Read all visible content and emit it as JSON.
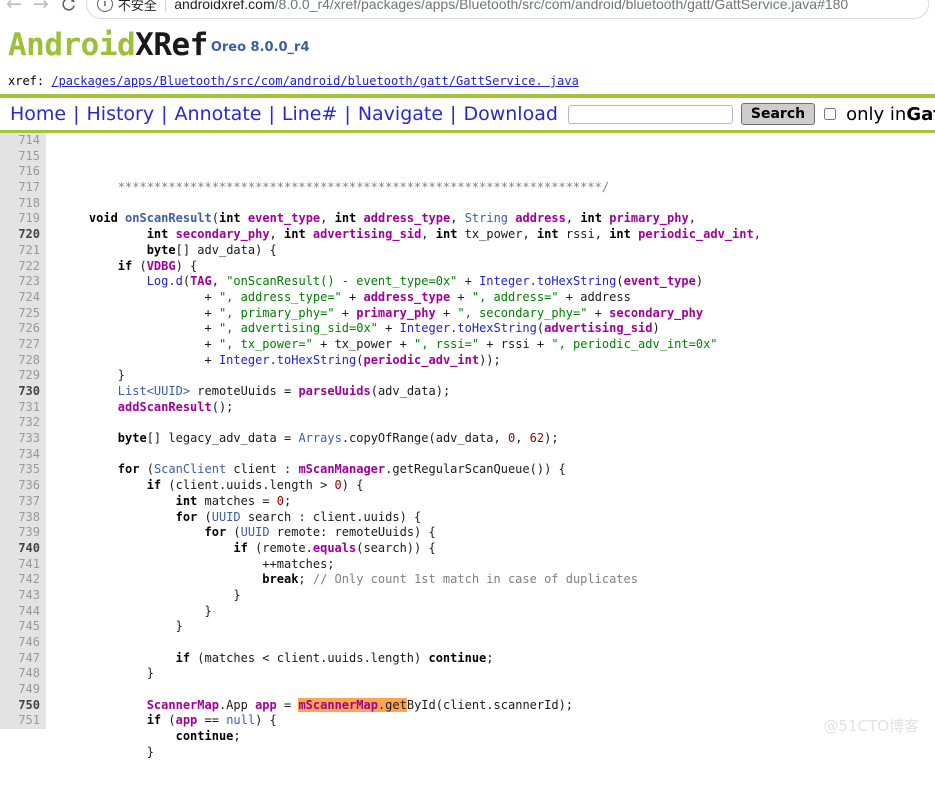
{
  "browser": {
    "back_icon": "back-arrow-icon",
    "forward_icon": "forward-arrow-icon",
    "reload_icon": "reload-icon",
    "info_icon": "info-circle-icon",
    "security_label": "不安全",
    "url_host": "androidxref.com",
    "url_path": "/8.0.0_r4/xref/packages/apps/Bluetooth/src/com/android/bluetooth/gatt/GattService.java#180",
    "url_full": "androidxref.com/8.0.0_r4/xref/packages/apps/Bluetooth/src/com/android/bluetooth/gatt/GattService.java#180"
  },
  "header": {
    "logo_android": "Android",
    "logo_xref": "XRef",
    "version": "Oreo 8.0.0_r4",
    "accent_green": "#a2c63b",
    "logo_green": "#9dc03b",
    "link_blue": "#2929cc"
  },
  "xref": {
    "label": "xref:",
    "segments": [
      "/packages",
      "/apps",
      "/Bluetooth",
      "/src",
      "/com",
      "/android",
      "/bluetooth",
      "/gatt",
      "/GattService. java"
    ],
    "full": "/packages/apps/Bluetooth/src/com/android/bluetooth/gatt/GattService. java"
  },
  "menu": {
    "links": [
      "Home",
      "History",
      "Annotate",
      "Line#",
      "Navigate",
      "Download"
    ],
    "separator": "|",
    "search_value": "",
    "search_placeholder": "",
    "search_button": "Search",
    "only_checked": false,
    "only_label": "only in",
    "only_file": "GattService"
  },
  "code": {
    "highlight_color": "#ffa64d",
    "first_line": 714,
    "lines": [
      {
        "n": 714,
        "tokens": [
          {
            "t": "        ",
            "c": "plain"
          },
          {
            "t": "*******************************************************************/",
            "c": "cmt"
          }
        ]
      },
      {
        "n": 715,
        "tokens": []
      },
      {
        "n": 716,
        "tokens": [
          {
            "t": "    ",
            "c": "plain"
          },
          {
            "t": "void",
            "c": "kw"
          },
          {
            "t": " ",
            "c": "plain"
          },
          {
            "t": "onScanResult",
            "c": "methdef"
          },
          {
            "t": "(",
            "c": "plain"
          },
          {
            "t": "int",
            "c": "kw"
          },
          {
            "t": " ",
            "c": "plain"
          },
          {
            "t": "event_type",
            "c": "id"
          },
          {
            "t": ", ",
            "c": "plain"
          },
          {
            "t": "int",
            "c": "kw"
          },
          {
            "t": " ",
            "c": "plain"
          },
          {
            "t": "address_type",
            "c": "id"
          },
          {
            "t": ", ",
            "c": "plain"
          },
          {
            "t": "String",
            "c": "type"
          },
          {
            "t": " ",
            "c": "plain"
          },
          {
            "t": "address",
            "c": "id"
          },
          {
            "t": ", ",
            "c": "plain"
          },
          {
            "t": "int",
            "c": "kw"
          },
          {
            "t": " ",
            "c": "plain"
          },
          {
            "t": "primary_phy",
            "c": "id"
          },
          {
            "t": ",",
            "c": "plain"
          }
        ]
      },
      {
        "n": 717,
        "tokens": [
          {
            "t": "            ",
            "c": "plain"
          },
          {
            "t": "int",
            "c": "kw"
          },
          {
            "t": " ",
            "c": "plain"
          },
          {
            "t": "secondary_phy",
            "c": "id"
          },
          {
            "t": ", ",
            "c": "plain"
          },
          {
            "t": "int",
            "c": "kw"
          },
          {
            "t": " ",
            "c": "plain"
          },
          {
            "t": "advertising_sid",
            "c": "id"
          },
          {
            "t": ", ",
            "c": "plain"
          },
          {
            "t": "int",
            "c": "kw"
          },
          {
            "t": " ",
            "c": "plain"
          },
          {
            "t": "tx_power",
            "c": "plain"
          },
          {
            "t": ", ",
            "c": "plain"
          },
          {
            "t": "int",
            "c": "kw"
          },
          {
            "t": " ",
            "c": "plain"
          },
          {
            "t": "rssi",
            "c": "plain"
          },
          {
            "t": ", ",
            "c": "plain"
          },
          {
            "t": "int",
            "c": "kw"
          },
          {
            "t": " ",
            "c": "plain"
          },
          {
            "t": "periodic_adv_int",
            "c": "id"
          },
          {
            "t": ",",
            "c": "plain"
          }
        ]
      },
      {
        "n": 718,
        "tokens": [
          {
            "t": "            ",
            "c": "plain"
          },
          {
            "t": "byte",
            "c": "kw"
          },
          {
            "t": "[] ",
            "c": "plain"
          },
          {
            "t": "adv_data",
            "c": "plain"
          },
          {
            "t": ") {",
            "c": "plain"
          }
        ]
      },
      {
        "n": 719,
        "tokens": [
          {
            "t": "        ",
            "c": "plain"
          },
          {
            "t": "if",
            "c": "kw"
          },
          {
            "t": " (",
            "c": "plain"
          },
          {
            "t": "VDBG",
            "c": "id"
          },
          {
            "t": ") {",
            "c": "plain"
          }
        ]
      },
      {
        "n": 720,
        "tokens": [
          {
            "t": "            ",
            "c": "plain"
          },
          {
            "t": "Log.d",
            "c": "meth"
          },
          {
            "t": "(",
            "c": "plain"
          },
          {
            "t": "TAG",
            "c": "id"
          },
          {
            "t": ", ",
            "c": "plain"
          },
          {
            "t": "\"onScanResult() - event_type=0x\"",
            "c": "str"
          },
          {
            "t": " + ",
            "c": "plain"
          },
          {
            "t": "Integer.toHexString",
            "c": "meth"
          },
          {
            "t": "(",
            "c": "plain"
          },
          {
            "t": "event_type",
            "c": "id"
          },
          {
            "t": ")",
            "c": "plain"
          }
        ]
      },
      {
        "n": 721,
        "tokens": [
          {
            "t": "                    + ",
            "c": "plain"
          },
          {
            "t": "\", address_type=\"",
            "c": "str"
          },
          {
            "t": " + ",
            "c": "plain"
          },
          {
            "t": "address_type",
            "c": "id"
          },
          {
            "t": " + ",
            "c": "plain"
          },
          {
            "t": "\", address=\"",
            "c": "str"
          },
          {
            "t": " + ",
            "c": "plain"
          },
          {
            "t": "address",
            "c": "plain"
          }
        ]
      },
      {
        "n": 722,
        "tokens": [
          {
            "t": "                    + ",
            "c": "plain"
          },
          {
            "t": "\", primary_phy=\"",
            "c": "str"
          },
          {
            "t": " + ",
            "c": "plain"
          },
          {
            "t": "primary_phy",
            "c": "id"
          },
          {
            "t": " + ",
            "c": "plain"
          },
          {
            "t": "\", secondary_phy=\"",
            "c": "str"
          },
          {
            "t": " + ",
            "c": "plain"
          },
          {
            "t": "secondary_phy",
            "c": "id"
          }
        ]
      },
      {
        "n": 723,
        "tokens": [
          {
            "t": "                    + ",
            "c": "plain"
          },
          {
            "t": "\", advertising_sid=0x\"",
            "c": "str"
          },
          {
            "t": " + ",
            "c": "plain"
          },
          {
            "t": "Integer.toHexString",
            "c": "meth"
          },
          {
            "t": "(",
            "c": "plain"
          },
          {
            "t": "advertising_sid",
            "c": "id"
          },
          {
            "t": ")",
            "c": "plain"
          }
        ]
      },
      {
        "n": 724,
        "tokens": [
          {
            "t": "                    + ",
            "c": "plain"
          },
          {
            "t": "\", tx_power=\"",
            "c": "str"
          },
          {
            "t": " + ",
            "c": "plain"
          },
          {
            "t": "tx_power",
            "c": "plain"
          },
          {
            "t": " + ",
            "c": "plain"
          },
          {
            "t": "\", rssi=\"",
            "c": "str"
          },
          {
            "t": " + ",
            "c": "plain"
          },
          {
            "t": "rssi",
            "c": "plain"
          },
          {
            "t": " + ",
            "c": "plain"
          },
          {
            "t": "\", periodic_adv_int=0x\"",
            "c": "str"
          }
        ]
      },
      {
        "n": 725,
        "tokens": [
          {
            "t": "                    + ",
            "c": "plain"
          },
          {
            "t": "Integer.toHexString",
            "c": "meth"
          },
          {
            "t": "(",
            "c": "plain"
          },
          {
            "t": "periodic_adv_int",
            "c": "id"
          },
          {
            "t": "));",
            "c": "plain"
          }
        ]
      },
      {
        "n": 726,
        "tokens": [
          {
            "t": "        }",
            "c": "plain"
          }
        ]
      },
      {
        "n": 727,
        "tokens": [
          {
            "t": "        ",
            "c": "plain"
          },
          {
            "t": "List<UUID>",
            "c": "type"
          },
          {
            "t": " ",
            "c": "plain"
          },
          {
            "t": "remoteUuids",
            "c": "plain"
          },
          {
            "t": " = ",
            "c": "plain"
          },
          {
            "t": "parseUuids",
            "c": "id"
          },
          {
            "t": "(",
            "c": "plain"
          },
          {
            "t": "adv_data",
            "c": "plain"
          },
          {
            "t": ");",
            "c": "plain"
          }
        ]
      },
      {
        "n": 728,
        "tokens": [
          {
            "t": "        ",
            "c": "plain"
          },
          {
            "t": "addScanResult",
            "c": "id"
          },
          {
            "t": "();",
            "c": "plain"
          }
        ]
      },
      {
        "n": 729,
        "tokens": []
      },
      {
        "n": 730,
        "tokens": [
          {
            "t": "        ",
            "c": "plain"
          },
          {
            "t": "byte",
            "c": "kw"
          },
          {
            "t": "[] ",
            "c": "plain"
          },
          {
            "t": "legacy_adv_data",
            "c": "plain"
          },
          {
            "t": " = ",
            "c": "plain"
          },
          {
            "t": "Arrays",
            "c": "type"
          },
          {
            "t": ".copyOfRange(",
            "c": "plain"
          },
          {
            "t": "adv_data",
            "c": "plain"
          },
          {
            "t": ", ",
            "c": "plain"
          },
          {
            "t": "0",
            "c": "num"
          },
          {
            "t": ", ",
            "c": "plain"
          },
          {
            "t": "62",
            "c": "num"
          },
          {
            "t": ");",
            "c": "plain"
          }
        ]
      },
      {
        "n": 731,
        "tokens": []
      },
      {
        "n": 732,
        "tokens": [
          {
            "t": "        ",
            "c": "plain"
          },
          {
            "t": "for",
            "c": "kw"
          },
          {
            "t": " (",
            "c": "plain"
          },
          {
            "t": "ScanClient",
            "c": "type"
          },
          {
            "t": " client : ",
            "c": "plain"
          },
          {
            "t": "mScanManager",
            "c": "id"
          },
          {
            "t": ".getRegularScanQueue()) {",
            "c": "plain"
          }
        ]
      },
      {
        "n": 733,
        "tokens": [
          {
            "t": "            ",
            "c": "plain"
          },
          {
            "t": "if",
            "c": "kw"
          },
          {
            "t": " (client.uuids.length > ",
            "c": "plain"
          },
          {
            "t": "0",
            "c": "num"
          },
          {
            "t": ") {",
            "c": "plain"
          }
        ]
      },
      {
        "n": 734,
        "tokens": [
          {
            "t": "                ",
            "c": "plain"
          },
          {
            "t": "int",
            "c": "kw"
          },
          {
            "t": " matches = ",
            "c": "plain"
          },
          {
            "t": "0",
            "c": "num"
          },
          {
            "t": ";",
            "c": "plain"
          }
        ]
      },
      {
        "n": 735,
        "tokens": [
          {
            "t": "                ",
            "c": "plain"
          },
          {
            "t": "for",
            "c": "kw"
          },
          {
            "t": " (",
            "c": "plain"
          },
          {
            "t": "UUID",
            "c": "type"
          },
          {
            "t": " search : client.uuids) {",
            "c": "plain"
          }
        ]
      },
      {
        "n": 736,
        "tokens": [
          {
            "t": "                    ",
            "c": "plain"
          },
          {
            "t": "for",
            "c": "kw"
          },
          {
            "t": " (",
            "c": "plain"
          },
          {
            "t": "UUID",
            "c": "type"
          },
          {
            "t": " remote: remoteUuids) {",
            "c": "plain"
          }
        ]
      },
      {
        "n": 737,
        "tokens": [
          {
            "t": "                        ",
            "c": "plain"
          },
          {
            "t": "if",
            "c": "kw"
          },
          {
            "t": " (remote.",
            "c": "plain"
          },
          {
            "t": "equals",
            "c": "id"
          },
          {
            "t": "(search)) {",
            "c": "plain"
          }
        ]
      },
      {
        "n": 738,
        "tokens": [
          {
            "t": "                            ++matches;",
            "c": "plain"
          }
        ]
      },
      {
        "n": 739,
        "tokens": [
          {
            "t": "                            ",
            "c": "plain"
          },
          {
            "t": "break",
            "c": "kw"
          },
          {
            "t": "; ",
            "c": "plain"
          },
          {
            "t": "// Only count 1st match in case of duplicates",
            "c": "cmt"
          }
        ]
      },
      {
        "n": 740,
        "tokens": [
          {
            "t": "                        }",
            "c": "plain"
          }
        ]
      },
      {
        "n": 741,
        "tokens": [
          {
            "t": "                    }",
            "c": "plain"
          }
        ]
      },
      {
        "n": 742,
        "tokens": [
          {
            "t": "                }",
            "c": "plain"
          }
        ]
      },
      {
        "n": 743,
        "tokens": []
      },
      {
        "n": 744,
        "tokens": [
          {
            "t": "                ",
            "c": "plain"
          },
          {
            "t": "if",
            "c": "kw"
          },
          {
            "t": " (matches < client.uuids.length) ",
            "c": "plain"
          },
          {
            "t": "continue",
            "c": "kw"
          },
          {
            "t": ";",
            "c": "plain"
          }
        ]
      },
      {
        "n": 745,
        "tokens": [
          {
            "t": "            }",
            "c": "plain"
          }
        ]
      },
      {
        "n": 746,
        "tokens": []
      },
      {
        "n": 747,
        "tokens": [
          {
            "t": "            ",
            "c": "plain"
          },
          {
            "t": "ScannerMap",
            "c": "id"
          },
          {
            "t": ".App ",
            "c": "plain"
          },
          {
            "t": "app",
            "c": "id"
          },
          {
            "t": " = ",
            "c": "plain"
          },
          {
            "t": "mScannerMap",
            "c": "id hl"
          },
          {
            "t": ".",
            "c": "plain hl"
          },
          {
            "t": "get",
            "c": "plain hl"
          },
          {
            "t": "ById(client.scannerId);",
            "c": "plain"
          }
        ]
      },
      {
        "n": 748,
        "tokens": [
          {
            "t": "            ",
            "c": "plain"
          },
          {
            "t": "if",
            "c": "kw"
          },
          {
            "t": " (",
            "c": "plain"
          },
          {
            "t": "app",
            "c": "id"
          },
          {
            "t": " == ",
            "c": "plain"
          },
          {
            "t": "null",
            "c": "type"
          },
          {
            "t": ") {",
            "c": "plain"
          }
        ]
      },
      {
        "n": 749,
        "tokens": [
          {
            "t": "                ",
            "c": "plain"
          },
          {
            "t": "continue",
            "c": "kw"
          },
          {
            "t": ";",
            "c": "plain"
          }
        ]
      },
      {
        "n": 750,
        "tokens": [
          {
            "t": "            }",
            "c": "plain"
          }
        ]
      },
      {
        "n": 751,
        "tokens": []
      }
    ]
  },
  "watermark": {
    "text": "@51CTO博客"
  }
}
